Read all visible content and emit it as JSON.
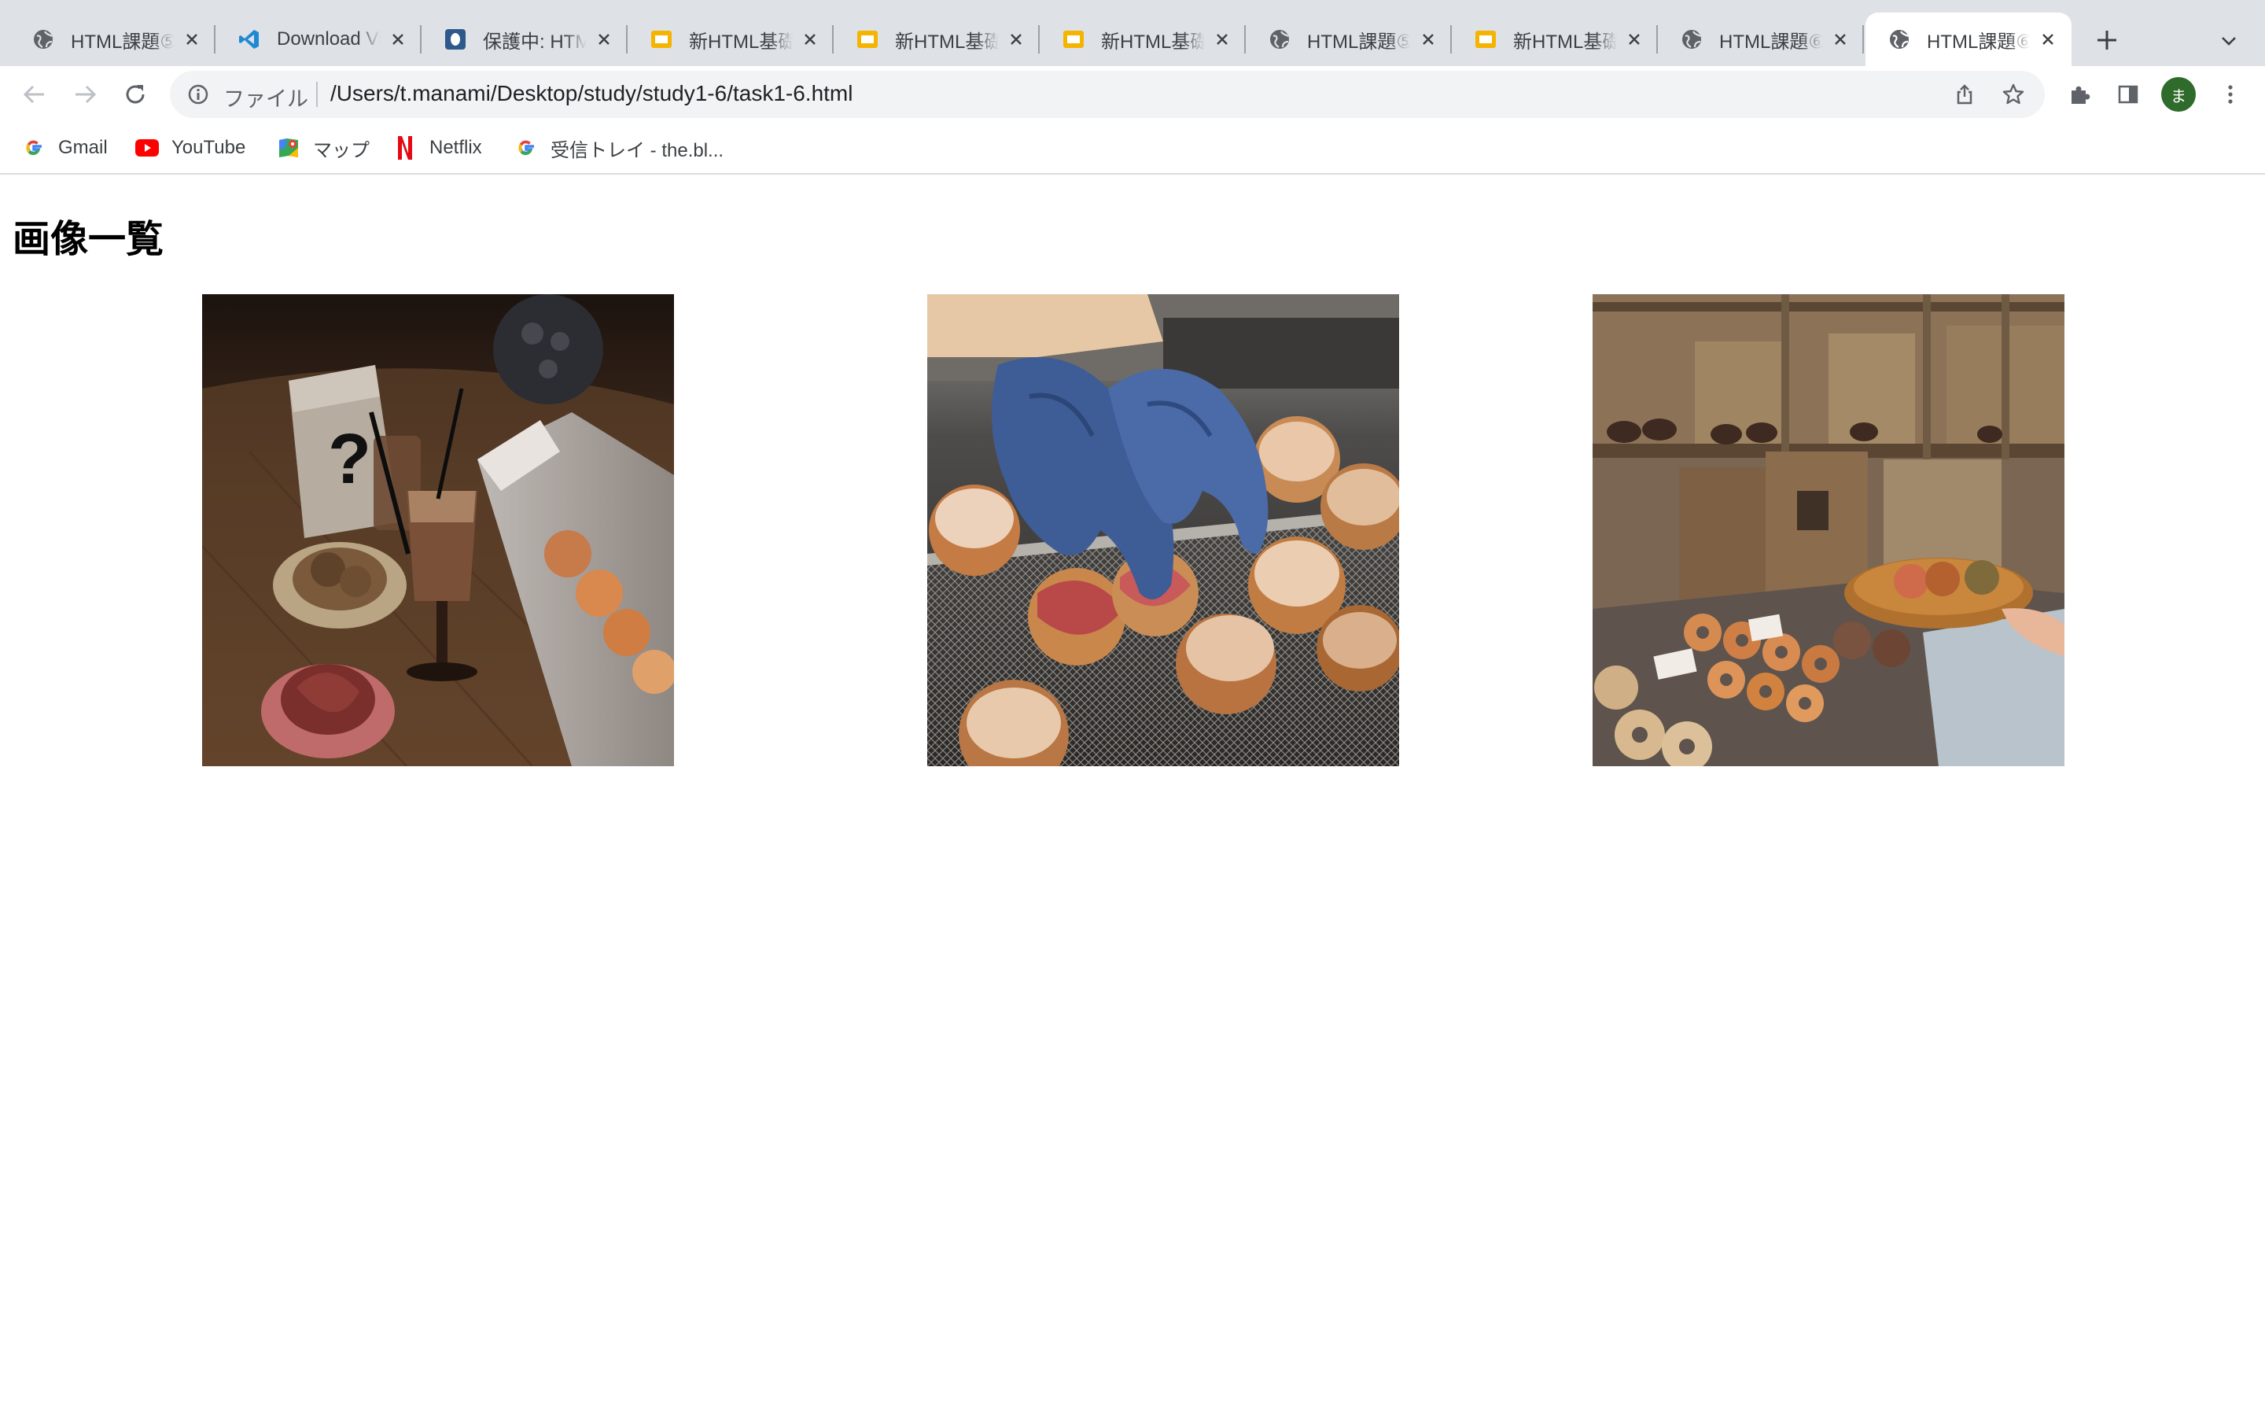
{
  "browser": {
    "tabs": [
      {
        "title": "HTML課題⑤",
        "favicon": "globe-icon"
      },
      {
        "title": "Download Visual Studio Code",
        "favicon": "vscode-icon"
      },
      {
        "title": "保護中: HTML",
        "favicon": "shield-page-icon"
      },
      {
        "title": "新HTML基礎",
        "favicon": "slides-icon"
      },
      {
        "title": "新HTML基礎",
        "favicon": "slides-icon"
      },
      {
        "title": "新HTML基礎",
        "favicon": "slides-icon"
      },
      {
        "title": "HTML課題⑤",
        "favicon": "globe-icon"
      },
      {
        "title": "新HTML基礎",
        "favicon": "slides-icon"
      },
      {
        "title": "HTML課題⑥",
        "favicon": "globe-icon"
      },
      {
        "title": "HTML課題⑥",
        "favicon": "globe-icon",
        "active": true
      }
    ],
    "omnibox": {
      "scheme_label": "ファイル",
      "url": "/Users/t.manami/Desktop/study/study1-6/task1-6.html"
    },
    "profile_initial": "ま",
    "bookmarks": [
      {
        "label": "Gmail",
        "icon": "google-icon"
      },
      {
        "label": "YouTube",
        "icon": "youtube-icon"
      },
      {
        "label": "マップ",
        "icon": "maps-icon"
      },
      {
        "label": "Netflix",
        "icon": "netflix-icon"
      },
      {
        "label": "受信トレイ - the.bl...",
        "icon": "google-icon"
      }
    ]
  },
  "page": {
    "heading": "画像一覧",
    "images": [
      {
        "subject": "donuts-and-iced-coffee"
      },
      {
        "subject": "gloved-hands-glazed-donuts"
      },
      {
        "subject": "donut-shop-display"
      }
    ]
  },
  "colors": {
    "tabstrip": "#dee1e6",
    "omnibox": "#f1f3f4",
    "avatar": "#2f6b2a"
  }
}
